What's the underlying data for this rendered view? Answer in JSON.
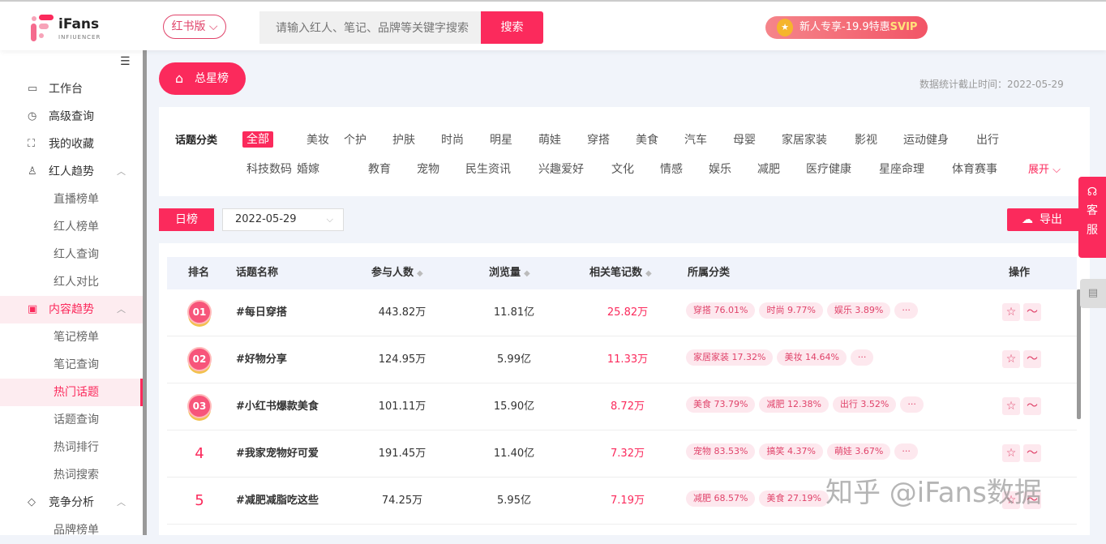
{
  "header": {
    "logo_title": "iFans",
    "logo_sub": "INFIUENCER",
    "version": "红书版",
    "search_placeholder": "请输入红人、笔记、品牌等关键字搜索",
    "search_button": "搜索",
    "promo_text": "新人专享-19.9特惠",
    "promo_highlight": "SVIP"
  },
  "sidebar": {
    "items": [
      {
        "label": "工作台",
        "icon": "monitor-icon",
        "type": "top"
      },
      {
        "label": "高级查询",
        "icon": "clock-icon",
        "type": "top"
      },
      {
        "label": "我的收藏",
        "icon": "scan-icon",
        "type": "top"
      },
      {
        "label": "红人趋势",
        "icon": "user-icon",
        "type": "parent"
      },
      {
        "label": "直播榜单",
        "type": "sub"
      },
      {
        "label": "红人榜单",
        "type": "sub"
      },
      {
        "label": "红人查询",
        "type": "sub"
      },
      {
        "label": "红人对比",
        "type": "sub"
      },
      {
        "label": "内容趋势",
        "icon": "content-icon",
        "type": "parent-active"
      },
      {
        "label": "笔记榜单",
        "type": "sub"
      },
      {
        "label": "笔记查询",
        "type": "sub"
      },
      {
        "label": "热门话题",
        "type": "sub-active"
      },
      {
        "label": "话题查询",
        "type": "sub"
      },
      {
        "label": "热词排行",
        "type": "sub"
      },
      {
        "label": "热词搜索",
        "type": "sub"
      },
      {
        "label": "竞争分析",
        "icon": "diamond-icon",
        "type": "parent"
      },
      {
        "label": "品牌榜单",
        "type": "sub"
      }
    ]
  },
  "main": {
    "board_button": "总星榜",
    "as_of": "数据统计截止时间：2022-05-29",
    "topic_label": "话题分类",
    "topics_row1": [
      "全部",
      "美妆",
      "个护",
      "护肤",
      "时尚",
      "明星",
      "萌娃",
      "穿搭",
      "美食",
      "汽车",
      "母婴",
      "家居家装",
      "影视",
      "运动健身",
      "出行"
    ],
    "topics_row2": [
      "科技数码",
      "婚嫁",
      "教育",
      "宠物",
      "民生资讯",
      "兴趣爱好",
      "文化",
      "情感",
      "娱乐",
      "减肥",
      "医疗健康",
      "星座命理",
      "体育赛事"
    ],
    "expand": "展开",
    "day_button": "日榜",
    "date": "2022-05-29",
    "export": "导出",
    "columns": [
      "排名",
      "话题名称",
      "参与人数",
      "浏览量",
      "相关笔记数",
      "所属分类",
      "操作"
    ],
    "rows": [
      {
        "rank": "01",
        "name": "#每日穿搭",
        "participants": "443.82万",
        "views": "11.81亿",
        "notes": "25.82万",
        "cats": [
          "穿搭 76.01%",
          "时尚 9.77%",
          "娱乐 3.89%",
          "···"
        ]
      },
      {
        "rank": "02",
        "name": "#好物分享",
        "participants": "124.95万",
        "views": "5.99亿",
        "notes": "11.33万",
        "cats": [
          "家居家装 17.32%",
          "美妆 14.64%",
          "···"
        ]
      },
      {
        "rank": "03",
        "name": "#小红书爆款美食",
        "participants": "101.11万",
        "views": "15.90亿",
        "notes": "8.72万",
        "cats": [
          "美食 73.79%",
          "减肥 12.38%",
          "出行 3.52%",
          "···"
        ]
      },
      {
        "rank": "4",
        "name": "#我家宠物好可爱",
        "participants": "191.45万",
        "views": "11.40亿",
        "notes": "7.32万",
        "cats": [
          "宠物 83.53%",
          "搞笑 4.37%",
          "萌娃 3.67%",
          "···"
        ]
      },
      {
        "rank": "5",
        "name": "#减肥减脂吃这些",
        "participants": "74.25万",
        "views": "5.95亿",
        "notes": "7.19万",
        "cats": [
          "减肥 68.57%",
          "美食 27.19%"
        ]
      }
    ]
  },
  "float": {
    "service": "客服"
  },
  "watermark": "知乎 @iFans数据",
  "colors": {
    "accent": "#fb2a5c",
    "pill_bg": "#fde8ee"
  }
}
